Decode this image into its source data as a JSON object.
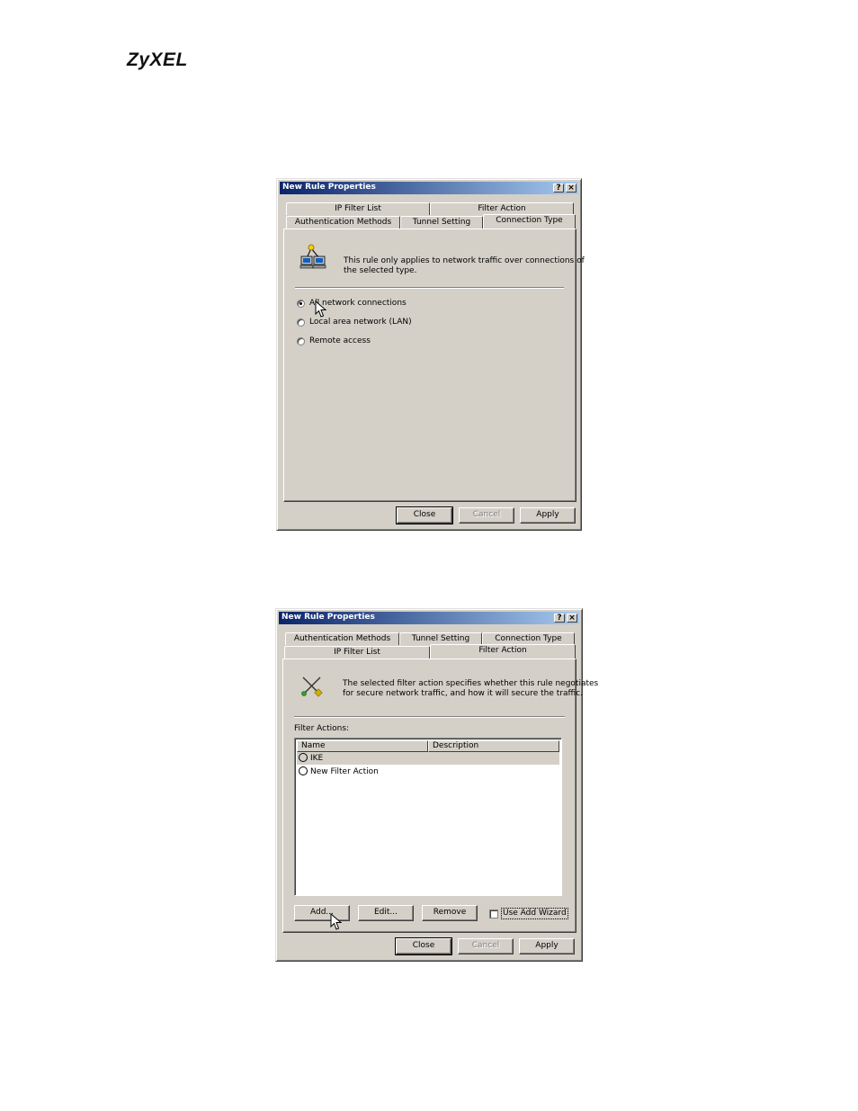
{
  "brand": "ZyXEL",
  "dialog1": {
    "title": "New Rule Properties",
    "tabs_back": [
      "IP Filter List",
      "Filter Action"
    ],
    "tabs_front": [
      "Authentication Methods",
      "Tunnel Setting",
      "Connection Type"
    ],
    "selected_tab": "Connection Type",
    "description_line1": "This rule only applies to network traffic over connections of",
    "description_line2": "the selected type.",
    "radios": [
      {
        "label": "All network connections",
        "checked": true
      },
      {
        "label": "Local area network (LAN)",
        "checked": false
      },
      {
        "label": "Remote access",
        "checked": false
      }
    ],
    "buttons": {
      "close": "Close",
      "cancel": "Cancel",
      "apply": "Apply"
    }
  },
  "dialog2": {
    "title": "New Rule Properties",
    "tabs_back": [
      "Authentication Methods",
      "Tunnel Setting",
      "Connection Type"
    ],
    "tabs_front": [
      "IP Filter List",
      "Filter Action"
    ],
    "selected_tab": "Filter Action",
    "description_line1": "The selected filter action specifies whether this rule negotiates",
    "description_line2": "for secure network traffic, and how it will secure the traffic.",
    "list_label": "Filter Actions:",
    "columns": [
      "Name",
      "Description"
    ],
    "rows": [
      {
        "name": "IKE",
        "description": ""
      },
      {
        "name": "New Filter Action",
        "description": ""
      }
    ],
    "action_buttons": {
      "add": "Add...",
      "edit": "Edit...",
      "remove": "Remove"
    },
    "wizard_checkbox": {
      "label": "Use Add Wizard",
      "checked": false
    },
    "buttons": {
      "close": "Close",
      "cancel": "Cancel",
      "apply": "Apply"
    }
  }
}
